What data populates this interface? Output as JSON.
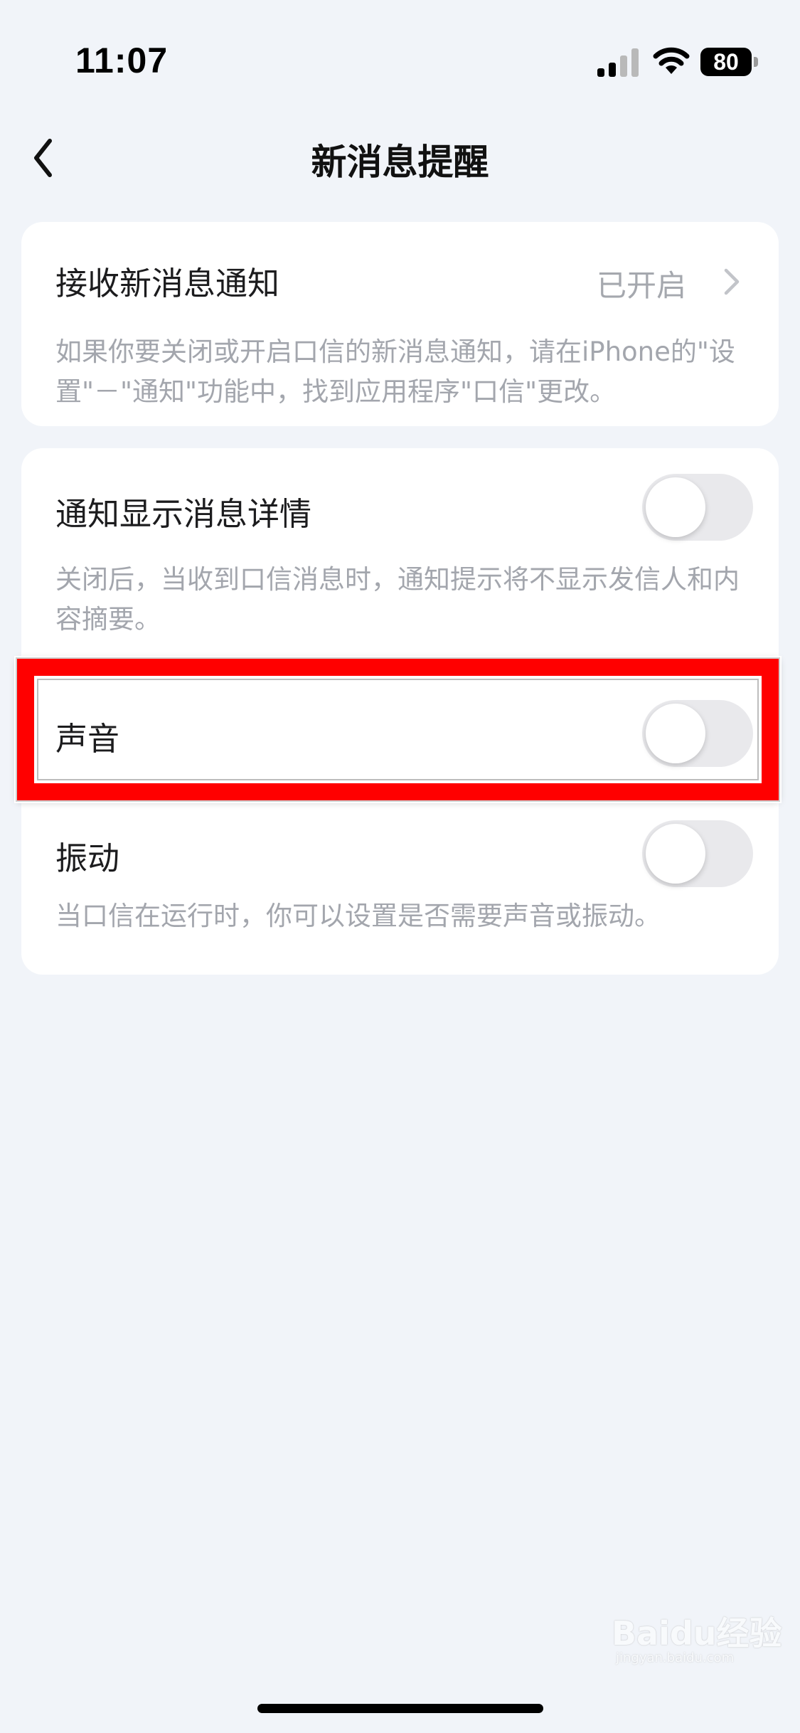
{
  "status_bar": {
    "time": "11:07",
    "battery_level": "80",
    "icons": [
      "signal-icon",
      "wifi-icon",
      "battery-icon"
    ]
  },
  "nav": {
    "title": "新消息提醒",
    "back_icon": "chevron-left-icon"
  },
  "receive_notifications": {
    "label": "接收新消息通知",
    "value": "已开启",
    "description": "如果你要关闭或开启口信的新消息通知，请在iPhone的\"设置\"－\"通知\"功能中，找到应用程序\"口信\"更改。"
  },
  "show_details": {
    "label": "通知显示消息详情",
    "enabled": false,
    "description": "关闭后，当收到口信消息时，通知提示将不显示发信人和内容摘要。"
  },
  "sound": {
    "label": "声音",
    "enabled": false,
    "highlighted": true,
    "highlight_color": "#ff0000"
  },
  "vibration": {
    "label": "振动",
    "enabled": false,
    "description": "当口信在运行时，你可以设置是否需要声音或振动。"
  },
  "watermark": {
    "text": "Baidu经验",
    "sub": "jingyan.baidu.com"
  },
  "colors": {
    "background": "#f1f4f9",
    "card": "#ffffff",
    "toggle_off": "#e9e9ec",
    "secondary_text": "#a3a6ad"
  }
}
